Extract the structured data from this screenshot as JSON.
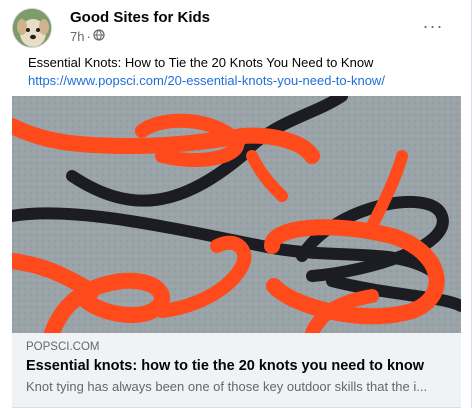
{
  "post": {
    "page_name": "Good Sites for Kids",
    "time": "7h",
    "separator": "·",
    "audience_icon": "globe-icon",
    "more_icon": "more-options-icon",
    "more_label": "···",
    "text": "Essential Knots: How to Tie the 20 Knots You Need to Know",
    "link": "https://www.popsci.com/20-essential-knots-you-need-to-know/"
  },
  "preview": {
    "domain": "POPSCI.COM",
    "title": "Essential knots: how to tie the 20 knots you need to know",
    "description": "Knot tying has always been one of those key outdoor skills that the i..."
  },
  "colors": {
    "rope_orange": "#ff4a1c",
    "rope_black": "#1b1d22",
    "link": "#216fdb",
    "preview_bg": "#f0f2f5"
  }
}
